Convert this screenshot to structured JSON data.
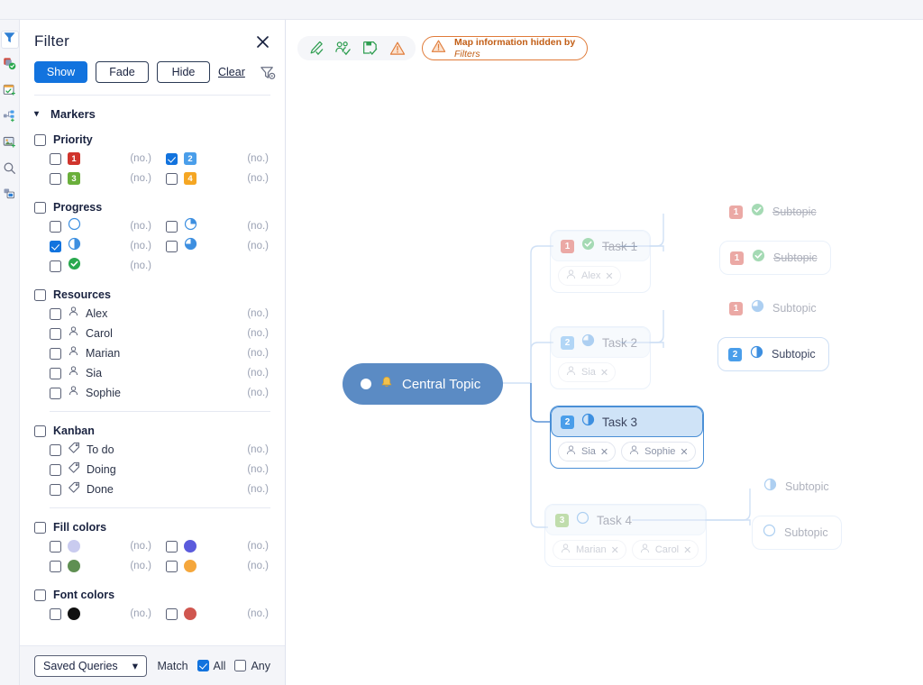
{
  "rail": {
    "items": [
      {
        "name": "filter-icon",
        "active": true
      },
      {
        "name": "markers-icon",
        "active": false
      },
      {
        "name": "task-calendar-icon",
        "active": false
      },
      {
        "name": "relationship-icon",
        "active": false
      },
      {
        "name": "image-icon",
        "active": false
      },
      {
        "name": "search-icon",
        "active": false
      },
      {
        "name": "overview-icon",
        "active": false
      }
    ]
  },
  "filter": {
    "title": "Filter",
    "close_label": "✕",
    "modes": [
      {
        "label": "Show",
        "selected": true
      },
      {
        "label": "Fade",
        "selected": false
      },
      {
        "label": "Hide",
        "selected": false
      }
    ],
    "clear_label": "Clear",
    "markers_label": "Markers",
    "count_placeholder": "(no.)",
    "groups": [
      {
        "title": "Priority",
        "checked": false,
        "layout": "two-column",
        "items": [
          {
            "label": "1",
            "type": "priority",
            "color": "#d0342c",
            "checked": false,
            "count": "(no.)"
          },
          {
            "label": "2",
            "type": "priority",
            "color": "#4a9eea",
            "checked": true,
            "count": "(no.)"
          },
          {
            "label": "3",
            "type": "priority",
            "color": "#6aaf3b",
            "checked": false,
            "count": "(no.)"
          },
          {
            "label": "4",
            "type": "priority",
            "color": "#f5a623",
            "checked": false,
            "count": "(no.)"
          }
        ]
      },
      {
        "title": "Progress",
        "checked": false,
        "layout": "two-column",
        "items": [
          {
            "label": "",
            "type": "progress",
            "state": "0",
            "checked": false,
            "count": "(no.)"
          },
          {
            "label": "",
            "type": "progress",
            "state": "25",
            "checked": false,
            "count": "(no.)"
          },
          {
            "label": "",
            "type": "progress",
            "state": "50",
            "checked": true,
            "count": "(no.)"
          },
          {
            "label": "",
            "type": "progress",
            "state": "75",
            "checked": false,
            "count": "(no.)"
          },
          {
            "label": "",
            "type": "progress",
            "state": "done",
            "checked": false,
            "count": "(no.)"
          }
        ]
      },
      {
        "title": "Resources",
        "checked": false,
        "layout": "list",
        "items": [
          {
            "label": "Alex",
            "type": "person",
            "checked": false,
            "count": "(no.)"
          },
          {
            "label": "Carol",
            "type": "person",
            "checked": false,
            "count": "(no.)"
          },
          {
            "label": "Marian",
            "type": "person",
            "checked": false,
            "count": "(no.)"
          },
          {
            "label": "Sia",
            "type": "person",
            "checked": false,
            "count": "(no.)"
          },
          {
            "label": "Sophie",
            "type": "person",
            "checked": false,
            "count": "(no.)"
          }
        ]
      },
      {
        "title": "Kanban",
        "checked": false,
        "layout": "list",
        "items": [
          {
            "label": "To do",
            "type": "tag",
            "checked": false,
            "count": "(no.)"
          },
          {
            "label": "Doing",
            "type": "tag",
            "checked": false,
            "count": "(no.)"
          },
          {
            "label": "Done",
            "type": "tag",
            "checked": false,
            "count": "(no.)"
          }
        ]
      },
      {
        "title": "Fill colors",
        "checked": false,
        "layout": "two-column",
        "items": [
          {
            "label": "",
            "type": "swatch",
            "color": "#c9cbef",
            "checked": false,
            "count": "(no.)"
          },
          {
            "label": "",
            "type": "swatch",
            "color": "#5b5bdc",
            "checked": false,
            "count": "(no.)"
          },
          {
            "label": "",
            "type": "swatch",
            "color": "#5f8f52",
            "checked": false,
            "count": "(no.)"
          },
          {
            "label": "",
            "type": "swatch",
            "color": "#f5a73c",
            "checked": false,
            "count": "(no.)"
          }
        ]
      },
      {
        "title": "Font colors",
        "checked": false,
        "layout": "two-column",
        "items": [
          {
            "label": "",
            "type": "swatch",
            "color": "#111111",
            "checked": false,
            "count": "(no.)"
          },
          {
            "label": "",
            "type": "swatch",
            "color": "#d0564f",
            "checked": false,
            "count": "(no.)"
          }
        ]
      }
    ],
    "footer": {
      "saved_queries_label": "Saved Queries",
      "match_label": "Match",
      "all_label": "All",
      "all_checked": true,
      "any_label": "Any",
      "any_checked": false
    }
  },
  "canvas": {
    "toolbar": {
      "icons": [
        "pen-check-icon",
        "people-check-icon",
        "save-check-icon",
        "warning-triangle-icon"
      ],
      "warning": {
        "title": "Map information hidden by",
        "subtitle": "Filters"
      }
    },
    "central": {
      "label": "Central Topic"
    },
    "tasks": [
      {
        "label": "Task 1",
        "priority": "1",
        "priority_color": "#d0342c",
        "progress": "done",
        "faded": true,
        "strike": true,
        "selected": false,
        "resources": [
          {
            "label": "Alex"
          }
        ],
        "subtopics": [
          {
            "label": "Subtopic",
            "priority": "1",
            "priority_color": "#d0342c",
            "progress": "done",
            "faded": true,
            "strike": true,
            "boxed": false
          },
          {
            "label": "Subtopic",
            "priority": "1",
            "priority_color": "#d0342c",
            "progress": "done",
            "faded": true,
            "strike": true,
            "boxed": true
          }
        ]
      },
      {
        "label": "Task 2",
        "priority": "2",
        "priority_color": "#4a9eea",
        "progress": "75",
        "faded": true,
        "strike": false,
        "selected": false,
        "resources": [
          {
            "label": "Sia"
          }
        ],
        "subtopics": [
          {
            "label": "Subtopic",
            "priority": "1",
            "priority_color": "#d0342c",
            "progress": "75",
            "faded": true,
            "strike": false,
            "boxed": false
          },
          {
            "label": "Subtopic",
            "priority": "2",
            "priority_color": "#4a9eea",
            "progress": "50",
            "faded": false,
            "strike": false,
            "boxed": true
          }
        ]
      },
      {
        "label": "Task 3",
        "priority": "2",
        "priority_color": "#4a9eea",
        "progress": "50",
        "faded": false,
        "strike": false,
        "selected": true,
        "resources": [
          {
            "label": "Sia"
          },
          {
            "label": "Sophie"
          }
        ],
        "subtopics": []
      },
      {
        "label": "Task 4",
        "priority": "3",
        "priority_color": "#6aaf3b",
        "progress": "0",
        "faded": true,
        "strike": false,
        "selected": false,
        "resources": [
          {
            "label": "Marian"
          },
          {
            "label": "Carol"
          }
        ],
        "subtopics": [
          {
            "label": "Subtopic",
            "priority": "",
            "priority_color": "",
            "progress": "50",
            "faded": true,
            "strike": false,
            "boxed": false
          },
          {
            "label": "Subtopic",
            "priority": "",
            "priority_color": "",
            "progress": "0",
            "faded": true,
            "strike": false,
            "boxed": true
          }
        ]
      }
    ]
  }
}
